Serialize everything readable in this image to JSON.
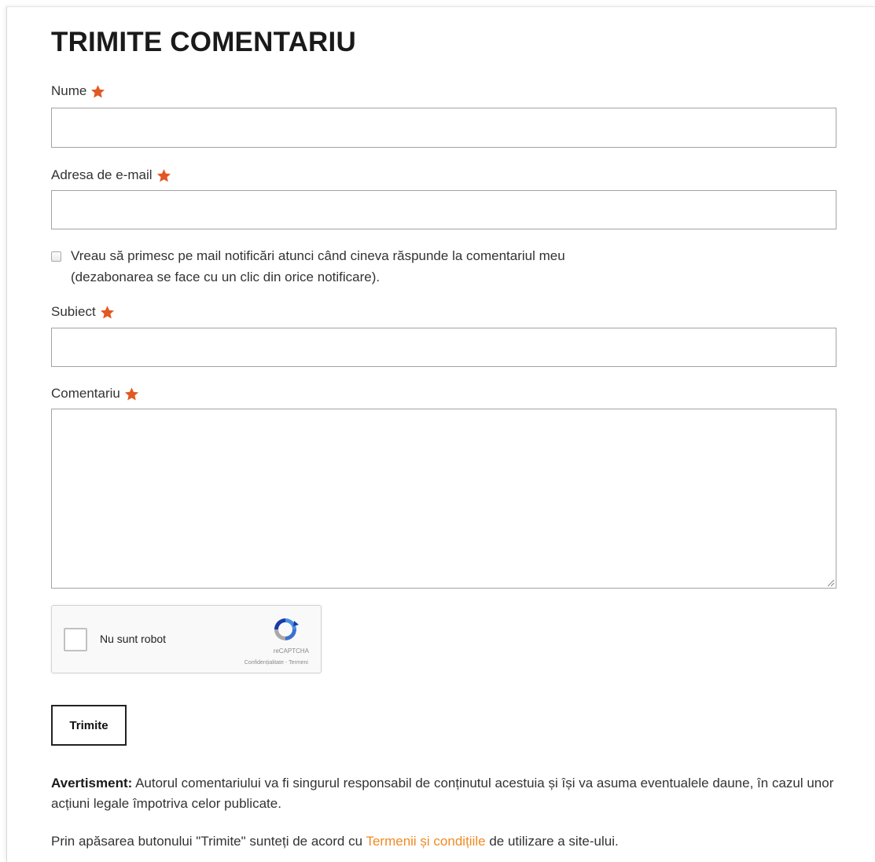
{
  "form": {
    "title": "TRIMITE COMENTARIU",
    "fields": {
      "name": {
        "label": "Nume",
        "value": ""
      },
      "email": {
        "label": "Adresa de e-mail",
        "value": ""
      },
      "subject": {
        "label": "Subiect",
        "value": ""
      },
      "comment": {
        "label": "Comentariu",
        "value": ""
      }
    },
    "notify": {
      "checked": false,
      "line1": "Vreau să primesc pe mail notificări atunci când cineva răspunde la comentariul meu",
      "line2": "(dezabonarea se face cu un clic din orice notificare)."
    },
    "captcha": {
      "label": "Nu sunt robot",
      "brand": "reCAPTCHA",
      "links": "Confidențialitate - Termeni"
    },
    "submit_label": "Trimite",
    "warning": {
      "bold": "Avertisment:",
      "text": " Autorul comentariului va fi singurul responsabil de conținutul acestuia și își va asuma eventualele daune, în cazul unor acțiuni legale împotriva celor publicate."
    },
    "agreement": {
      "before": "Prin apăsarea butonului \"Trimite\" sunteți de acord cu ",
      "link": "Termenii și condițiile",
      "after": " de utilizare a site-ului."
    }
  },
  "colors": {
    "required_star": "#e25822",
    "link": "#f08a24",
    "border": "#a3a3a3"
  },
  "icons": {
    "required": "star-icon",
    "captcha": "recaptcha-logo-icon",
    "textarea_resize": "resize-grip-icon"
  }
}
